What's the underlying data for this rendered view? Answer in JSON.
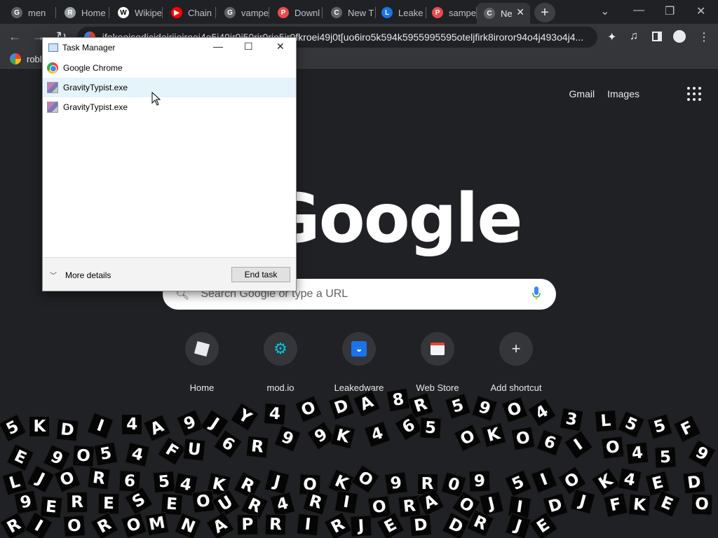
{
  "tabs": [
    {
      "title": "men",
      "favicon": "G",
      "fav_color": "#5f6368"
    },
    {
      "title": "Home",
      "favicon": "R",
      "fav_color": "#9aa0a6"
    },
    {
      "title": "Wikipe",
      "favicon": "W",
      "fav_color": "#ffffff"
    },
    {
      "title": "Chain",
      "favicon": "YT",
      "fav_color": "#ff0000"
    },
    {
      "title": "vampe",
      "favicon": "G",
      "fav_color": "#5f6368"
    },
    {
      "title": "Downl",
      "favicon": "P",
      "fav_color": "#e94b4b"
    },
    {
      "title": "New T",
      "favicon": "C",
      "fav_color": "#5f6368"
    },
    {
      "title": "Leake",
      "favicon": "L",
      "fav_color": "#1a73e8"
    },
    {
      "title": "sampe",
      "favicon": "P",
      "fav_color": "#e94b4b"
    },
    {
      "title": "Ne",
      "favicon": "C",
      "fav_color": "#5f6368"
    }
  ],
  "omnibox": {
    "url": "ifokeoisodicidoirijoiroei4o5i49ir9i50rir9rio5ir9fkroei49j0t[uo6iro5k594k5955995595oteljfirk8iroror94o4j493o4j4..."
  },
  "bookmarks": [
    {
      "label": "robl"
    }
  ],
  "ntp": {
    "gmail": "Gmail",
    "images": "Images",
    "logo_text": "Google",
    "search_placeholder": "Search Google or type a URL",
    "shortcuts": [
      {
        "label": "Home",
        "icon": "roblox-icon"
      },
      {
        "label": "mod.io",
        "icon": "gear-icon"
      },
      {
        "label": "Leakedware",
        "icon": "leakedware-icon"
      },
      {
        "label": "Web Store",
        "icon": "webstore-icon"
      },
      {
        "label": "Add shortcut",
        "icon": "plus-icon"
      }
    ]
  },
  "task_manager": {
    "title": "Task Manager",
    "processes": [
      {
        "name": "Google Chrome",
        "icon": "chrome-icon",
        "selected": false
      },
      {
        "name": "GravityTypist.exe",
        "icon": "app-icon",
        "selected": true
      },
      {
        "name": "GravityTypist.exe",
        "icon": "app-icon",
        "selected": false
      }
    ],
    "more_details": "More details",
    "end_task": "End task"
  },
  "game_tiles": {
    "letters": [
      "5",
      "K",
      "D",
      "I",
      "4",
      "A",
      "9",
      "J",
      "Y",
      "4",
      "O",
      "D",
      "A",
      "8",
      "R",
      "5",
      "9",
      "O",
      "4",
      "3",
      "L",
      "5",
      "5",
      "F",
      "E",
      "9",
      "O",
      "5",
      "4",
      "F",
      "U",
      "6",
      "R",
      "9",
      "9",
      "K",
      "4",
      "6",
      "5",
      "O",
      "K",
      "O",
      "6",
      "I",
      "O",
      "4",
      "5",
      "9",
      "L",
      "J",
      "O",
      "R",
      "6",
      "5",
      "4",
      "K",
      "R",
      "J",
      "O",
      "K",
      "O",
      "9",
      "R",
      "0",
      "9",
      "5",
      "I",
      "O",
      "K",
      "4",
      "E",
      "D",
      "9",
      "E",
      "R",
      "E",
      "S",
      "E",
      "O",
      "U",
      "R",
      "4",
      "R",
      "I",
      "O",
      "R",
      "A",
      "O",
      "J",
      "I",
      "D",
      "J",
      "F",
      "K",
      "E",
      "O",
      "R",
      "I",
      "O",
      "R",
      "O",
      "M",
      "N",
      "A",
      "P",
      "R",
      "I",
      "R",
      "J",
      "E",
      "D",
      "D",
      "R",
      "J",
      "E"
    ]
  }
}
